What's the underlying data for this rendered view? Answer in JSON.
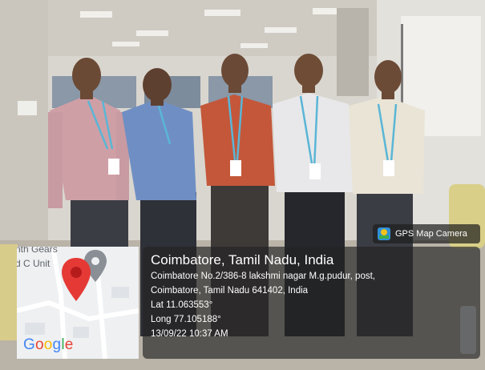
{
  "app": {
    "badge_label": "GPS Map Camera",
    "badge_icon": "gps-map-camera-app-icon"
  },
  "location": {
    "title": "Coimbatore, Tamil Nadu, India",
    "address_line1": "Coimbatore No.2/386-8 lakshmi nagar M.g.pudur, post,",
    "address_line2": "Coimbatore, Tamil Nadu 641402, India",
    "latitude": "Lat 11.063553°",
    "longitude": "Long 77.105188°",
    "datetime": "13/09/22 10:37 AM"
  },
  "map": {
    "labels": [
      "nth Gears",
      "d C Unit"
    ],
    "marker_icon": "red-location-pin-icon",
    "user_icon": "gray-location-pin-icon",
    "brand": [
      "G",
      "o",
      "o",
      "g",
      "l",
      "e"
    ],
    "brand_colors": [
      "#4285F4",
      "#EA4335",
      "#FBBC05",
      "#4285F4",
      "#34A853",
      "#EA4335"
    ]
  }
}
